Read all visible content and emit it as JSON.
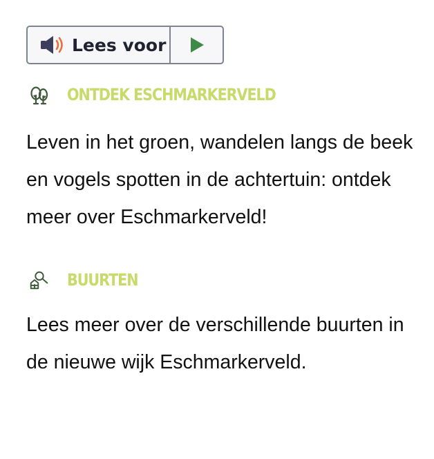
{
  "readspeaker": {
    "listen_label": "Lees voor"
  },
  "sections": [
    {
      "heading": "Ontdek Eschmarkerveld",
      "text": "Leven in het groen, wandelen langs de beek en vogels spotten in de achtertuin: ontdek meer over Eschmarkerveld!",
      "icon": "trees-icon"
    },
    {
      "heading": "Buurten",
      "text": "Lees meer over de verschillende buurten in de nieuwe wijk Eschmarkerveld.",
      "icon": "house-search-icon"
    }
  ],
  "colors": {
    "heading": "#c7da6a",
    "icon": "#3f5a3a",
    "play": "#3f8a47",
    "speaker": "#3b3f5c",
    "speaker_waves": "#e8713a"
  }
}
